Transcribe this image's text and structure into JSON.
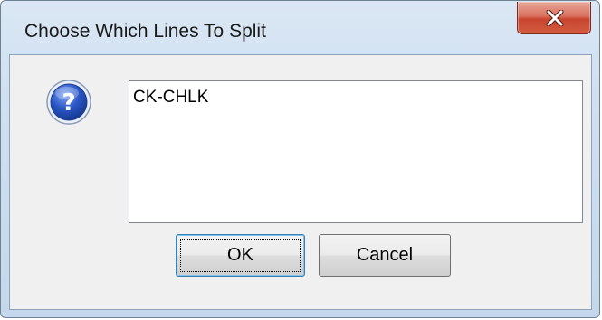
{
  "window": {
    "title": "Choose Which Lines To Split"
  },
  "icons": {
    "close": "close-icon",
    "question": "question-icon"
  },
  "list": {
    "items": [
      "CK-CHLK"
    ]
  },
  "buttons": {
    "ok_label": "OK",
    "cancel_label": "Cancel"
  },
  "colors": {
    "close_button": "#c8452f",
    "question_icon": "#2a56c6",
    "ok_focus_border": "#3c7fb1"
  }
}
